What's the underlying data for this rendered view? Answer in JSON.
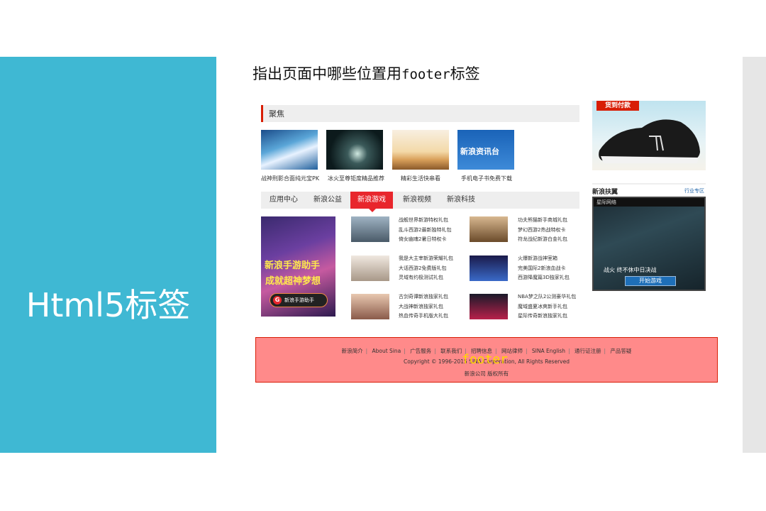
{
  "slide": {
    "left_title": "Html5标签",
    "question_prefix": "指出页面中哪些位置用",
    "question_code": "footer",
    "question_suffix": "标签"
  },
  "colors": {
    "left_panel": "#3fb8d3",
    "accent_red": "#e8262c",
    "footer_highlight": "#ff8a8a",
    "footer_label": "#ffd700"
  },
  "screenshot": {
    "focus": {
      "title": "聚焦"
    },
    "thumbs": [
      {
        "caption": "战神刑影合面纯元宝PK",
        "icon": "fantasy-woman-image"
      },
      {
        "caption": "冰火至尊钜度精品推荐",
        "icon": "night-sky-image"
      },
      {
        "caption": "精彩生活快串看",
        "icon": "desert-camel-image"
      },
      {
        "caption": "手机电子书免费下载",
        "icon": "sina-news-image"
      }
    ],
    "thumb3_text": "新浪资讯台",
    "tabs": [
      {
        "label": "应用中心",
        "active": false
      },
      {
        "label": "新浪公益",
        "active": false
      },
      {
        "label": "新浪游戏",
        "active": true
      },
      {
        "label": "新浪视频",
        "active": false
      },
      {
        "label": "新浪科技",
        "active": false
      }
    ],
    "banner": {
      "line1": "新浪手游助手",
      "line2": "成就超神梦想",
      "btn_icon": "G",
      "btn_text": "新浪手游助手"
    },
    "game_items": [
      {
        "lines": [
          "战舰世界新游特权礼包",
          "乱斗西游2最新独特礼包",
          "倚女幽魂2暑日特权卡"
        ]
      },
      {
        "lines": [
          "功夫熊猫新手商城礼包",
          "梦幻西游2热战特权卡",
          "符龙战纪新游白金礼包"
        ]
      },
      {
        "lines": [
          "我是大主宰新游荣耀礼包",
          "大话西游2免费版礼包",
          "灵域有约极测试礼包"
        ]
      },
      {
        "lines": [
          "火爆新游战神室箱",
          "完美国际2新浪血战卡",
          "西游降魔篇3D独家礼包"
        ]
      },
      {
        "lines": [
          "古剑奇谭新浪独家礼包",
          "大战神新浪独家礼包",
          "热血传奇手机版大礼包"
        ]
      },
      {
        "lines": [
          "NBA梦之队2公测豪华礼包",
          "魔域盛夏冰爽新手礼包",
          "星际传奇新浪独家礼包"
        ]
      }
    ],
    "shoe_tag": "货到付款",
    "fupin": {
      "title": "新浪扶翼",
      "more": "行业专区",
      "game_bar": "星际网络",
      "game_caption": "战火 终不休中日决战",
      "game_button": "开始游戏"
    },
    "footer": {
      "links": [
        "新浪简介",
        "About Sina",
        "广告服务",
        "联系我们",
        "招聘信息",
        "网站律师",
        "SINA English",
        "通行证注册",
        "产品答疑"
      ],
      "copyright": "Copyright © 1996-2015 SINA Corporation, All Rights Reserved",
      "company": "新浪公司 版权所有",
      "label": "footer"
    }
  }
}
